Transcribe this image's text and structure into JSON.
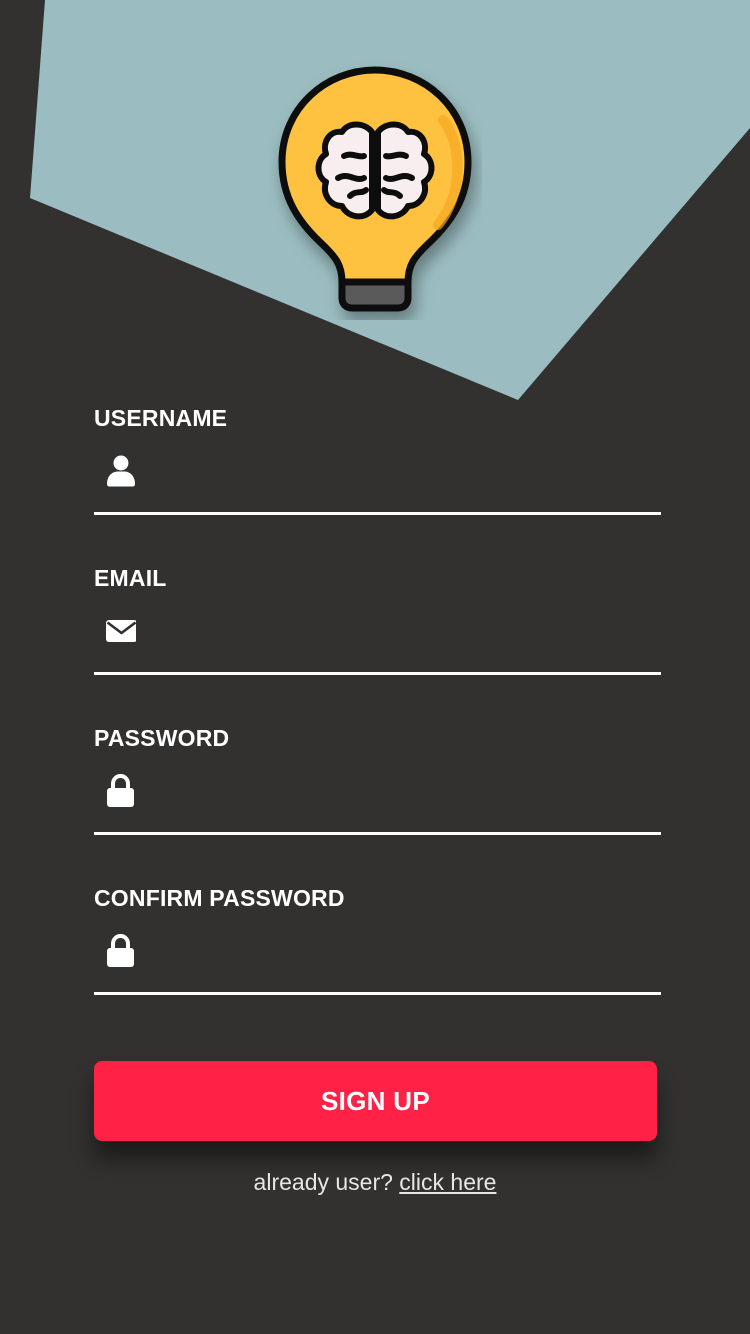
{
  "colors": {
    "background": "#323130",
    "header_shape": "#9bbdc1",
    "accent": "#ff2146",
    "bulb": "#ffc13f",
    "text": "#ffffff"
  },
  "header": {
    "logo_icon": "lightbulb-brain-icon"
  },
  "form": {
    "fields": [
      {
        "label": "USERNAME",
        "icon": "user-icon",
        "value": "",
        "placeholder": ""
      },
      {
        "label": "EMAIL",
        "icon": "envelope-icon",
        "value": "",
        "placeholder": ""
      },
      {
        "label": "PASSWORD",
        "icon": "lock-icon",
        "value": "",
        "placeholder": ""
      },
      {
        "label": "CONFIRM PASSWORD",
        "icon": "lock-icon",
        "value": "",
        "placeholder": ""
      }
    ],
    "submit_label": "SIGN UP"
  },
  "footer": {
    "prompt": "already user?",
    "link_label": "click here"
  }
}
